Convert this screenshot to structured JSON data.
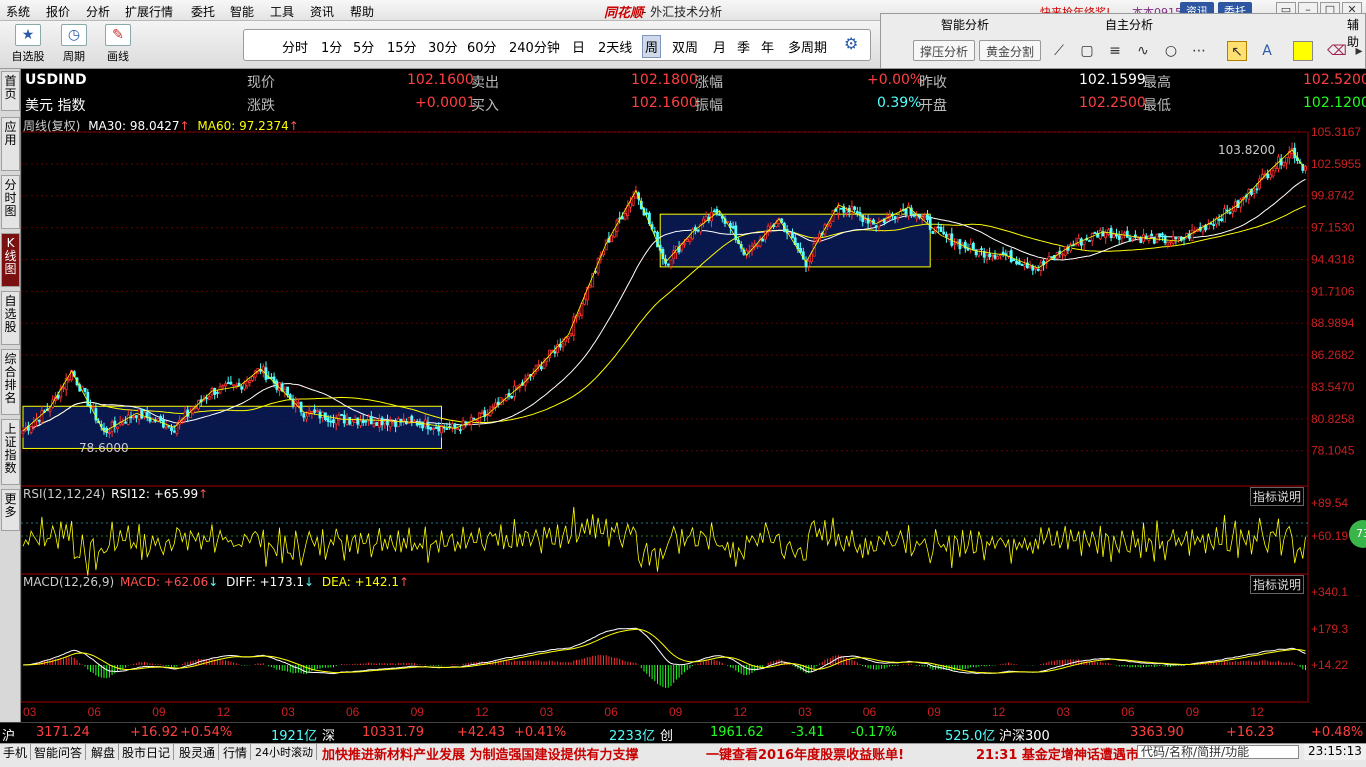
{
  "menu": [
    "系统",
    "报价",
    "分析",
    "扩展行情",
    "委托",
    "智能",
    "工具",
    "资讯",
    "帮助"
  ],
  "brand": {
    "logo": "同花顺",
    "subtitle": "- 外汇技术分析"
  },
  "promo": "快来抢年终奖!",
  "account": "本本0915",
  "top_buttons": {
    "news": "资讯",
    "trade": "委托"
  },
  "toolbar": {
    "watchlist": "自选股",
    "cycle": "周期",
    "draw": "画线"
  },
  "periods": [
    "分时",
    "1分",
    "5分",
    "15分",
    "30分",
    "60分",
    "240分钟",
    "日",
    "2天线",
    "周",
    "双周",
    "月",
    "季",
    "年",
    "多周期"
  ],
  "selected_period": "周",
  "smart_panel": {
    "tab1": "智能分析",
    "tab2": "自主分析",
    "tab3": "辅助",
    "btn1": "撑压分析",
    "btn2": "黄金分割"
  },
  "sidebar": [
    "首页",
    "应用",
    "分时图",
    "K线图",
    "自选股",
    "综合排名",
    "上证指数",
    "更多"
  ],
  "sidebar_active": "K线图",
  "quote": {
    "symbol": "USDIND",
    "name": "美元 指数",
    "now_label": "现价",
    "now": "102.1600",
    "change_label": "涨跌",
    "change": "+0.0001",
    "sell_label": "卖出",
    "sell": "102.1800",
    "buy_label": "买入",
    "buy": "102.1600",
    "pct_label": "涨幅",
    "pct": "+0.00%",
    "amp_label": "振幅",
    "amp": "0.39%",
    "prev_label": "昨收",
    "prev": "102.1599",
    "open_label": "开盘",
    "open": "102.2500",
    "high_label": "最高",
    "high": "102.5200",
    "low_label": "最低",
    "low": "102.1200"
  },
  "main_legend": {
    "period": "周线(复权)",
    "ma30": "MA30: 98.0427",
    "ma60": "MA60: 97.2374"
  },
  "rsi_legend": {
    "name": "RSI(12,12,24)",
    "rsi12": "RSI12: +65.99"
  },
  "macd_legend": {
    "name": "MACD(12,26,9)",
    "macd": "MACD: +62.06",
    "diff": "DIFF: +173.1",
    "dea": "DEA: +142.1"
  },
  "indicator_btn": "指标说明",
  "annotations": {
    "hi": "103.8200",
    "lo": "78.6000",
    "rsi_badge": "73"
  },
  "colors": {
    "up": "#ff3030",
    "down": "#54ffff",
    "ma30": "#ffffff",
    "ma60": "#ffff00",
    "axis": "#c00000",
    "text": "#cccccc",
    "accent": "#ff5050"
  },
  "chart_data": {
    "type": "candlestick",
    "price_axis": [
      "105.3167",
      "102.5955",
      "99.8742",
      "97.1530",
      "94.4318",
      "91.7106",
      "88.9894",
      "86.2682",
      "83.5470",
      "80.8258",
      "78.1045"
    ],
    "ylim": [
      76.8,
      105.3167
    ],
    "rsi_axis": [
      "+89.54",
      "+60.19"
    ],
    "macd_axis": [
      "+340.1",
      "+179.3",
      "+14.22"
    ],
    "x_ticks": [
      "03",
      "06",
      "09",
      "12",
      "03",
      "06",
      "09",
      "12",
      "03",
      "06",
      "09",
      "12",
      "03",
      "06",
      "09",
      "12",
      "03",
      "06",
      "09",
      "12"
    ],
    "anchors": [
      [
        0,
        79.8
      ],
      [
        10,
        81.8
      ],
      [
        18,
        84.9
      ],
      [
        30,
        79.7
      ],
      [
        42,
        81.3
      ],
      [
        56,
        80.1
      ],
      [
        70,
        83.2
      ],
      [
        80,
        83.6
      ],
      [
        88,
        85.1
      ],
      [
        104,
        81.4
      ],
      [
        118,
        80.8
      ],
      [
        132,
        80.7
      ],
      [
        146,
        80.5
      ],
      [
        160,
        80.0
      ],
      [
        172,
        81.2
      ],
      [
        186,
        84.0
      ],
      [
        202,
        88.0
      ],
      [
        216,
        95.8
      ],
      [
        227,
        100.3
      ],
      [
        238,
        94.2
      ],
      [
        248,
        96.8
      ],
      [
        258,
        98.6
      ],
      [
        268,
        94.8
      ],
      [
        280,
        97.9
      ],
      [
        290,
        94.2
      ],
      [
        302,
        99.1
      ],
      [
        316,
        97.5
      ],
      [
        328,
        98.9
      ],
      [
        340,
        96.5
      ],
      [
        352,
        95.2
      ],
      [
        364,
        94.8
      ],
      [
        376,
        93.7
      ],
      [
        388,
        95.6
      ],
      [
        400,
        96.8
      ],
      [
        414,
        96.3
      ],
      [
        428,
        96.0
      ],
      [
        440,
        97.6
      ],
      [
        450,
        99.1
      ],
      [
        462,
        102.1
      ],
      [
        470,
        103.8
      ],
      [
        474,
        102.4
      ]
    ],
    "box1": {
      "start": 0,
      "end": 155,
      "top": 81.9,
      "bottom": 78.3
    },
    "box2": {
      "start": 236,
      "end": 336,
      "top": 98.3,
      "bottom": 93.8
    }
  },
  "ticker": {
    "sh_label": "沪",
    "sh": "3171.24",
    "sh_chg": "+16.92",
    "sh_pct": "+0.54%",
    "sz_vol": "1921亿",
    "sz_label": "深",
    "sz": "10331.79",
    "sz_chg": "+42.43",
    "sz_pct": "+0.41%",
    "cy_vol": "2233亿",
    "cy_label": "创",
    "cy": "1961.62",
    "cy_chg": "-3.41",
    "cy_pct": "-0.17%",
    "hs_vol": "525.0亿",
    "hs_label": "沪深300",
    "hs": "3363.90",
    "hs_chg": "+16.23",
    "hs_pct": "+0.48%"
  },
  "status": {
    "tabs": [
      "手机",
      "智能问答",
      "解盘",
      "股市日记",
      "股灵通",
      "行情",
      "24小时滚动"
    ],
    "news": "加快推进新材料产业发展 为制造强国建设提供有力支撑",
    "news2": "一键查看2016年度股票收益账单!",
    "time_news": "21:31 基金定增神话遭遇市",
    "search": "代码/名称/简拼/功能",
    "clock": "23:15:13"
  }
}
